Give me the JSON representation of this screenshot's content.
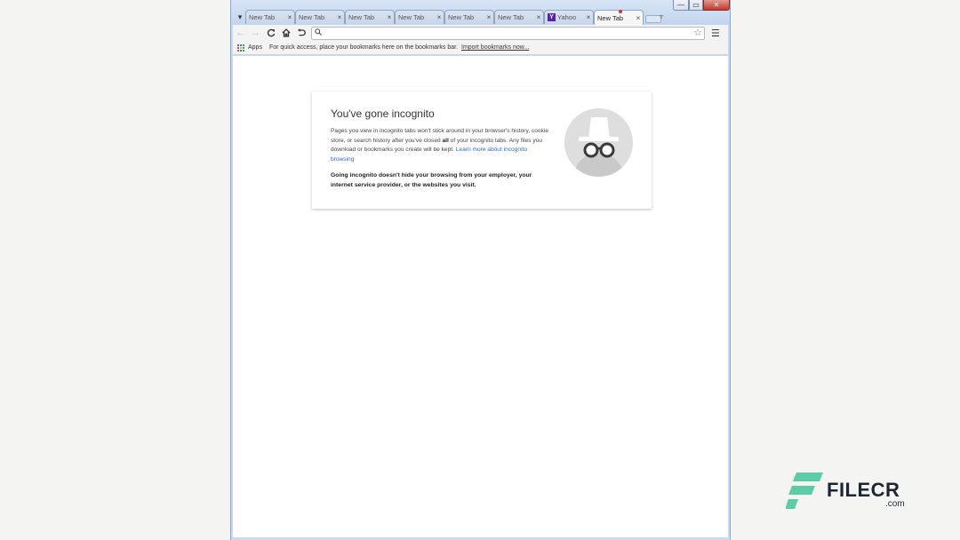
{
  "window": {
    "controls": {
      "minimize": "—",
      "maximize": "▭",
      "close": "✕"
    }
  },
  "tabs": [
    {
      "label": "New Tab",
      "close": "×"
    },
    {
      "label": "New Tab",
      "close": "×"
    },
    {
      "label": "New Tab",
      "close": "×"
    },
    {
      "label": "New Tab",
      "close": "×"
    },
    {
      "label": "New Tab",
      "close": "×"
    },
    {
      "label": "New Tab",
      "close": "×"
    },
    {
      "label": "Yahoo",
      "close": "×",
      "favicon": "Y"
    },
    {
      "label": "New Tab",
      "close": "×",
      "active": true
    }
  ],
  "toolbar": {
    "back_icon": "back-arrow-icon",
    "forward_icon": "forward-arrow-icon",
    "reload_icon": "reload-icon",
    "home_icon": "home-icon",
    "undo_icon": "undo-icon",
    "omnibox_value": "",
    "star_icon": "star-icon",
    "menu_icon": "hamburger-menu-icon"
  },
  "bookmarks": {
    "apps_label": "Apps",
    "hint": "For quick access, place your bookmarks here on the bookmarks bar.",
    "import_link": "Import bookmarks now..."
  },
  "incognito": {
    "title": "You've gone incognito",
    "p1_a": "Pages you view in incognito tabs won't stick around in your browser's history, cookie store, or search history after you've closed ",
    "p1_bold": "all",
    "p1_b": " of your incognito tabs. Any files you download or bookmarks you create will be kept. ",
    "learn_more": "Learn more about incognito browsing",
    "p2": "Going incognito doesn't hide your browsing from your employer, your internet service provider, or the websites you visit.",
    "icon": "incognito-spy-icon"
  },
  "watermark": {
    "name": "FILECR",
    "domain": ".com",
    "colors": {
      "accent": "#4fc3a1",
      "text": "#1c2736"
    }
  }
}
